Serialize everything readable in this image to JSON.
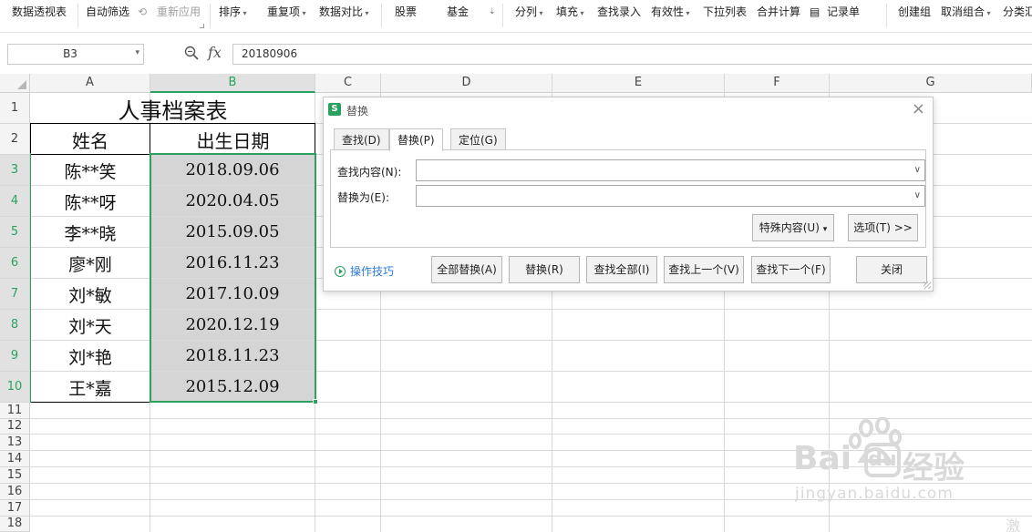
{
  "ribbon": {
    "items": [
      "数据透视表",
      "自动筛选",
      "重新应用",
      "排序",
      "重复项",
      "数据对比",
      "股票",
      "基金",
      "分列",
      "填充",
      "查找录入",
      "有效性",
      "下拉列表",
      "合并计算",
      "记录单",
      "创建组",
      "取消组合",
      "分类汇"
    ]
  },
  "formula_bar": {
    "name_box": "B3",
    "fx_label": "fx",
    "value": "20180906"
  },
  "columns": [
    "A",
    "B",
    "C",
    "D",
    "E",
    "F",
    "G"
  ],
  "rows": [
    "1",
    "2",
    "3",
    "4",
    "5",
    "6",
    "7",
    "8",
    "9",
    "10",
    "11",
    "12",
    "13",
    "14",
    "15",
    "16",
    "17",
    "18"
  ],
  "sheet": {
    "title": "人事档案表",
    "header_name": "姓名",
    "header_date": "出生日期",
    "records": [
      {
        "name": "陈**笑",
        "date": "2018.09.06"
      },
      {
        "name": "陈**呀",
        "date": "2020.04.05"
      },
      {
        "name": "李**晓",
        "date": "2015.09.05"
      },
      {
        "name": "廖*刚",
        "date": "2016.11.23"
      },
      {
        "name": "刘*敏",
        "date": "2017.10.09"
      },
      {
        "name": "刘*天",
        "date": "2020.12.19"
      },
      {
        "name": "刘*艳",
        "date": "2018.11.23"
      },
      {
        "name": "王*嘉",
        "date": "2015.12.09"
      }
    ]
  },
  "dialog": {
    "title": "替换",
    "tabs": [
      "查找(D)",
      "替换(P)",
      "定位(G)"
    ],
    "active_tab": "替换(P)",
    "find_label": "查找内容(N):",
    "find_value": "",
    "replace_label": "替换为(E):",
    "replace_value": "",
    "special_button": "特殊内容(U)",
    "options_button": "选项(T) >>",
    "tips_link": "操作技巧",
    "buttons": [
      "全部替换(A)",
      "替换(R)",
      "查找全部(I)",
      "查找上一个(V)",
      "查找下一个(F)",
      "关闭"
    ]
  },
  "watermark": {
    "brand": "Bai",
    "brand_cn": "经验",
    "url": "jingyan.baidu.com",
    "corner": "激活"
  },
  "colors": {
    "accent": "#2aa15f",
    "selection_fill": "#d5d5d5",
    "link": "#2b7bd6"
  }
}
